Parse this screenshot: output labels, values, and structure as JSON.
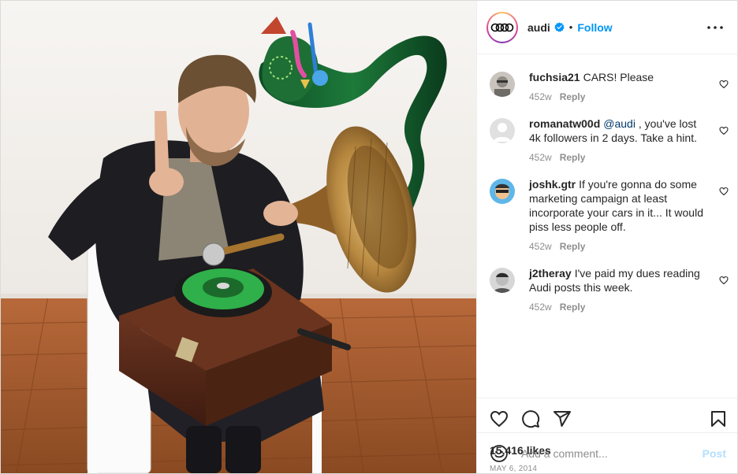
{
  "post": {
    "author": "audi",
    "follow_label": "Follow",
    "separator": "•",
    "likes": "15,416 likes",
    "date": "MAY 6, 2014",
    "comment_placeholder": "Add a comment...",
    "post_label": "Post"
  },
  "comments": [
    {
      "user": "fuchsia21",
      "segments": [
        {
          "text": "CARS! Please"
        }
      ],
      "age": "452w",
      "reply": "Reply"
    },
    {
      "user": "romanatw00d",
      "segments": [
        {
          "text": "@audi",
          "mention": true
        },
        {
          "text": " , you've lost 4k followers in 2 days. Take a hint."
        }
      ],
      "age": "452w",
      "reply": "Reply"
    },
    {
      "user": "joshk.gtr",
      "segments": [
        {
          "text": "If you're gonna do some marketing campaign at least incorporate your cars in it... It would piss less people off."
        }
      ],
      "age": "452w",
      "reply": "Reply"
    },
    {
      "user": "j2theray",
      "segments": [
        {
          "text": "I've paid my dues reading Audi posts this week."
        }
      ],
      "age": "452w",
      "reply": "Reply"
    }
  ],
  "icons": {
    "verified": "verified-badge-icon",
    "more": "more-options-icon",
    "like": "heart-icon",
    "comment": "comment-icon",
    "share": "share-icon",
    "save": "bookmark-icon",
    "emoji": "emoji-icon"
  },
  "colors": {
    "link_blue": "#0095f6",
    "post_disabled": "#b2dffc",
    "muted": "#8e8e8e",
    "text": "#262626"
  }
}
